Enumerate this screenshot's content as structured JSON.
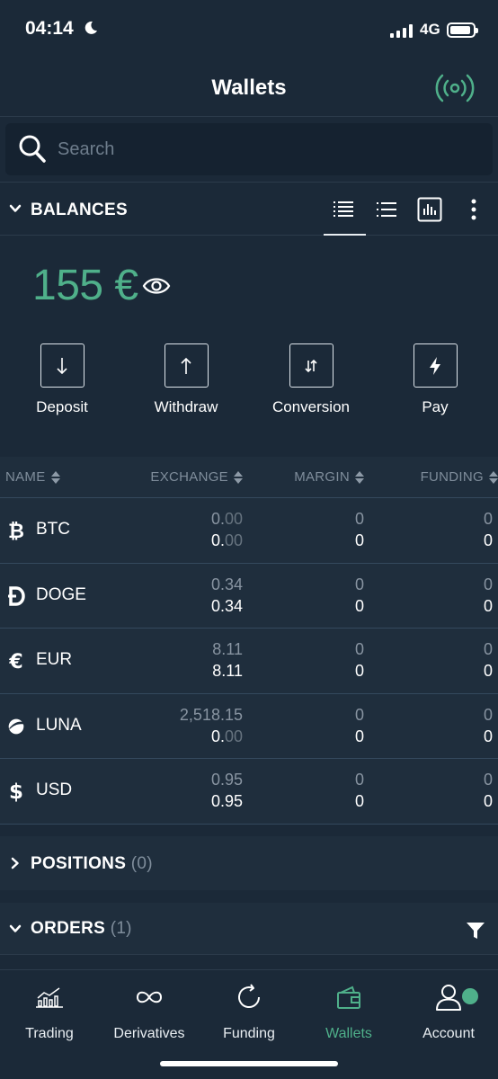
{
  "status": {
    "time": "04:14",
    "network": "4G"
  },
  "header": {
    "title": "Wallets"
  },
  "search": {
    "placeholder": "Search"
  },
  "balances": {
    "title": "BALANCES",
    "total": "155 €",
    "actions": [
      {
        "label": "Deposit"
      },
      {
        "label": "Withdraw"
      },
      {
        "label": "Conversion"
      },
      {
        "label": "Pay"
      }
    ]
  },
  "table": {
    "columns": [
      "NAME",
      "EXCHANGE",
      "MARGIN",
      "FUNDING"
    ],
    "rows": [
      {
        "name": "BTC",
        "icon": "bitcoin-icon",
        "exchange_top_main": "0.",
        "exchange_top_dim": "00",
        "exchange_bot_main": "0.",
        "exchange_bot_dim": "00",
        "margin_top": "0",
        "margin_bot": "0",
        "funding_top": "0",
        "funding_bot": "0"
      },
      {
        "name": "DOGE",
        "icon": "dogecoin-icon",
        "exchange_top_main": "0.34",
        "exchange_top_dim": "",
        "exchange_bot_main": "0.34",
        "exchange_bot_dim": "",
        "margin_top": "0",
        "margin_bot": "0",
        "funding_top": "0",
        "funding_bot": "0"
      },
      {
        "name": "EUR",
        "icon": "euro-icon",
        "exchange_top_main": "8.11",
        "exchange_top_dim": "",
        "exchange_bot_main": "8.11",
        "exchange_bot_dim": "",
        "margin_top": "0",
        "margin_bot": "0",
        "funding_top": "0",
        "funding_bot": "0"
      },
      {
        "name": "LUNA",
        "icon": "luna-icon",
        "exchange_top_main": "2,518.15",
        "exchange_top_dim": "",
        "exchange_bot_main": "0.",
        "exchange_bot_dim": "00",
        "margin_top": "0",
        "margin_bot": "0",
        "funding_top": "0",
        "funding_bot": "0"
      },
      {
        "name": "USD",
        "icon": "dollar-icon",
        "exchange_top_main": "0.95",
        "exchange_top_dim": "",
        "exchange_bot_main": "0.95",
        "exchange_bot_dim": "",
        "margin_top": "0",
        "margin_bot": "0",
        "funding_top": "0",
        "funding_bot": "0"
      }
    ]
  },
  "positions": {
    "title": "POSITIONS",
    "count": "(0)"
  },
  "orders": {
    "title": "ORDERS",
    "count": "(1)"
  },
  "tabs": [
    {
      "label": "Trading",
      "icon": "chart-icon"
    },
    {
      "label": "Derivatives",
      "icon": "infinity-icon"
    },
    {
      "label": "Funding",
      "icon": "refresh-icon"
    },
    {
      "label": "Wallets",
      "icon": "wallet-icon",
      "active": true
    },
    {
      "label": "Account",
      "icon": "user-icon"
    }
  ],
  "colors": {
    "accent": "#4fb08a",
    "background": "#1b2938",
    "table_bg": "#1f2e3d"
  }
}
